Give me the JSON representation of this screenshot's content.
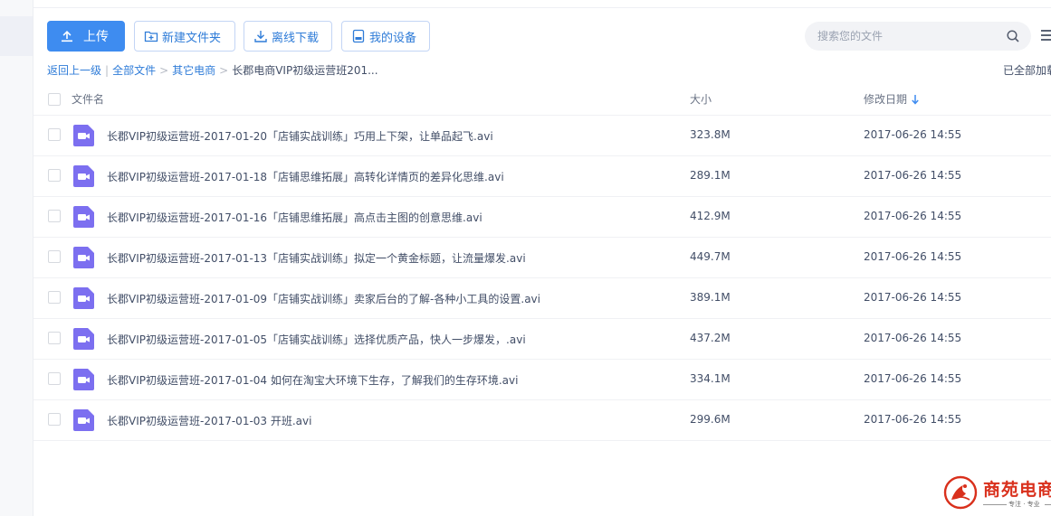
{
  "toolbar": {
    "upload_label": "上传",
    "new_folder_label": "新建文件夹",
    "offline_download_label": "离线下载",
    "my_devices_label": "我的设备"
  },
  "search": {
    "placeholder": "搜索您的文件"
  },
  "breadcrumb": {
    "back": "返回上一级",
    "separator": "|",
    "all_files": "全部文件",
    "arrow": ">",
    "level1": "其它电商",
    "current": "长郡电商VIP初级运营班201..."
  },
  "load_status": "已全部加载",
  "columns": {
    "name": "文件名",
    "size": "大小",
    "modified": "修改日期"
  },
  "files": [
    {
      "name": "长郡VIP初级运营班-2017-01-20「店铺实战训练」巧用上下架，让单品起飞.avi",
      "size": "323.8M",
      "modified": "2017-06-26 14:55"
    },
    {
      "name": "长郡VIP初级运营班-2017-01-18「店铺思维拓展」高转化详情页的差异化思维.avi",
      "size": "289.1M",
      "modified": "2017-06-26 14:55"
    },
    {
      "name": "长郡VIP初级运营班-2017-01-16「店铺思维拓展」高点击主图的创意思维.avi",
      "size": "412.9M",
      "modified": "2017-06-26 14:55"
    },
    {
      "name": "长郡VIP初级运营班-2017-01-13「店铺实战训练」拟定一个黄金标题，让流量爆发.avi",
      "size": "449.7M",
      "modified": "2017-06-26 14:55"
    },
    {
      "name": "长郡VIP初级运营班-2017-01-09「店铺实战训练」卖家后台的了解-各种小工具的设置.avi",
      "size": "389.1M",
      "modified": "2017-06-26 14:55"
    },
    {
      "name": "长郡VIP初级运营班-2017-01-05「店铺实战训练」选择优质产品，快人一步爆发，.avi",
      "size": "437.2M",
      "modified": "2017-06-26 14:55"
    },
    {
      "name": "长郡VIP初级运营班-2017-01-04 如何在淘宝大环境下生存，了解我们的生存环境.avi",
      "size": "334.1M",
      "modified": "2017-06-26 14:55"
    },
    {
      "name": "长郡VIP初级运营班-2017-01-03 开班.avi",
      "size": "299.6M",
      "modified": "2017-06-26 14:55"
    }
  ],
  "watermark": {
    "title": "商苑电商学院",
    "subtitle": "专注 · 专业"
  },
  "colors": {
    "accent": "#3e8cf0",
    "link": "#2f7cd8",
    "video_icon": "#7c6ff0",
    "watermark": "#d9301c"
  }
}
